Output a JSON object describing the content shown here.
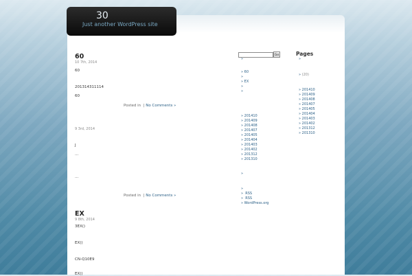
{
  "site": {
    "title": "30",
    "description": "Just another WordPress site"
  },
  "posts": [
    {
      "title": "60",
      "date": "10 7th, 2014",
      "paragraphs": [
        "60",
        "201314311114",
        "60"
      ],
      "meta_prefix": "Posted in",
      "comments": "No Comments »"
    },
    {
      "title": "",
      "date": "9 3rd, 2014",
      "paragraphs": [
        "J",
        "…",
        "…"
      ],
      "meta_prefix": "Posted in",
      "comments": "No Comments »"
    },
    {
      "title": "EX",
      "date": "9 8th, 2014",
      "paragraphs": [
        "3EX()",
        "EX()",
        "CN-Q10E9",
        "EX()"
      ]
    }
  ],
  "search": {
    "value": "",
    "button_label": "Go"
  },
  "sidebar_left": {
    "recent_bullet_1": "»",
    "recent": [
      "60",
      "",
      "EX"
    ],
    "extra_bullets": [
      "»",
      "»"
    ],
    "archives": [
      "201410",
      "201409",
      "201408",
      "201407",
      "201405",
      "201404",
      "201403",
      "201402",
      "201312",
      "201310"
    ],
    "cat_bullet": "»",
    "meta_bullets": [
      "»"
    ],
    "meta": [
      "RSS",
      "RSS",
      "WordPress.org"
    ]
  },
  "sidebar_right": {
    "pages_heading": "Pages",
    "pages_bullet": "»",
    "categories": [
      {
        "label": "",
        "count": "(20)"
      }
    ],
    "archives": [
      "201410",
      "201409",
      "201408",
      "201407",
      "201405",
      "201404",
      "201403",
      "201402",
      "201312",
      "201310"
    ]
  }
}
